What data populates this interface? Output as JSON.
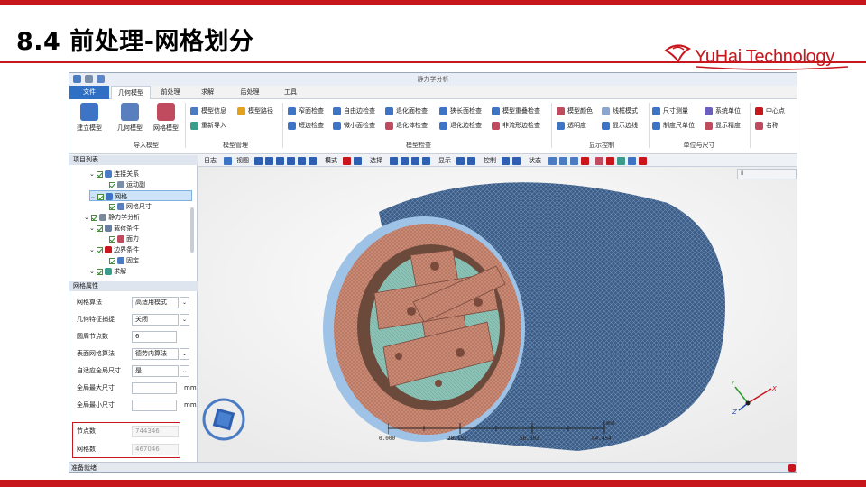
{
  "slide": {
    "title": "8.4 前处理-网格划分",
    "logo_text": "YuHai Technology",
    "accent_color": "#c8161d"
  },
  "app": {
    "window_title": "静力学分析",
    "menu": [
      "文件",
      "几何模型",
      "前处理",
      "求解",
      "后处理",
      "工具"
    ],
    "ribbon": {
      "import_group": {
        "label": "导入模型",
        "buttons": [
          "建立模型",
          "几何模型",
          "网格模型"
        ]
      },
      "manage_group": {
        "label": "模型管理",
        "buttons": [
          "模型信息",
          "模型路径",
          "重新导入"
        ]
      },
      "check_group": {
        "label": "模型检查",
        "buttons": [
          "窄面检查",
          "自由边检查",
          "退化面检查",
          "狭长面检查",
          "模型重叠检查",
          "短边检查",
          "微小面检查",
          "退化体检查",
          "退化边检查",
          "非流形边检查"
        ]
      },
      "display_group": {
        "label": "显示控制",
        "buttons": [
          "模型颜色",
          "线框模式",
          "透明度",
          "显示边线"
        ]
      },
      "unit_group": {
        "label": "单位与尺寸",
        "buttons": [
          "尺寸测量",
          "系统单位",
          "制度尺单位",
          "显示精度"
        ]
      },
      "extra": [
        "中心点",
        "名称"
      ]
    },
    "toolbar": [
      "日志",
      "视图",
      "模式",
      "选择",
      "显示",
      "控制",
      "状态"
    ],
    "tree": {
      "header": "项目列表",
      "items": [
        {
          "label": "连接关系",
          "level": 1
        },
        {
          "label": "运动副",
          "level": 2
        },
        {
          "label": "网格",
          "level": 1,
          "selected": true
        },
        {
          "label": "网格尺寸",
          "level": 2
        },
        {
          "label": "静力学分析",
          "level": 0
        },
        {
          "label": "载荷条件",
          "level": 1
        },
        {
          "label": "面力",
          "level": 2
        },
        {
          "label": "边界条件",
          "level": 1
        },
        {
          "label": "固定",
          "level": 2
        },
        {
          "label": "求解",
          "level": 1
        }
      ]
    },
    "properties": {
      "header": "网格属性",
      "rows": [
        {
          "label": "网格算法",
          "value": "高适用模式",
          "dropdown": true
        },
        {
          "label": "几何特征捕捉",
          "value": "关闭",
          "dropdown": true
        },
        {
          "label": "圆周节点数",
          "value": "6",
          "dropdown": false
        },
        {
          "label": "表面网格算法",
          "value": "德劳内算法",
          "dropdown": true
        },
        {
          "label": "自适应全局尺寸",
          "value": "是",
          "dropdown": true
        },
        {
          "label": "全局最大尺寸",
          "value": "",
          "unit": "mm"
        },
        {
          "label": "全局最小尺寸",
          "value": "",
          "unit": "mm"
        },
        {
          "label": "节点数",
          "value": "744346",
          "readonly": true
        },
        {
          "label": "网格数",
          "value": "467046",
          "readonly": true
        }
      ]
    },
    "scale_bar": {
      "ticks": [
        "0.000",
        "28.151",
        "56.303",
        "84.454"
      ],
      "unit": "(mm)"
    },
    "axes": {
      "x": "X",
      "y": "Y",
      "z": "Z"
    },
    "status": "准备就绪",
    "mini_window_title": "II"
  }
}
